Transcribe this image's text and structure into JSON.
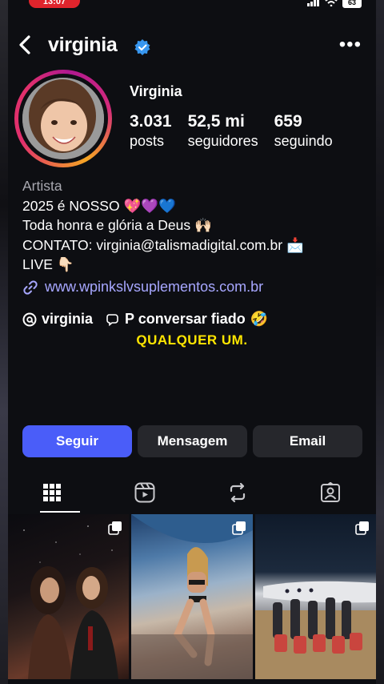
{
  "status_bar": {
    "time": "13:07",
    "battery": "63"
  },
  "header": {
    "username": "virginia",
    "more": "•••"
  },
  "profile": {
    "display_name": "Virginia",
    "stats": [
      {
        "value": "3.031",
        "label": "posts"
      },
      {
        "value": "52,5 mi",
        "label": "seguidores"
      },
      {
        "value": "659",
        "label": "seguindo"
      }
    ]
  },
  "bio": {
    "category": "Artista",
    "line1": "2025 é NOSSO",
    "line1_emoji": "💖💜💙",
    "line2": "Toda honra e glória a Deus",
    "line2_emoji": "🙌🏻",
    "line3": "CONTATO: virginia@talismadigital.com.br",
    "line3_emoji": "📩",
    "line4": "LIVE",
    "line4_emoji": "👇🏻",
    "link": "www.wpinkslvsuplementos.com.br",
    "threads_name": "virginia",
    "channel": "P conversar fiado",
    "channel_emoji": "🤣"
  },
  "caption": "QUALQUER UM.",
  "buttons": {
    "follow": "Seguir",
    "message": "Mensagem",
    "email": "Email"
  },
  "tabs": [
    "grid-icon",
    "reels-icon",
    "reposts-icon",
    "tagged-icon"
  ],
  "colors": {
    "follow": "#4a5df9",
    "link": "#a7a7ff",
    "caption": "#ffe600",
    "verified": "#3897f0"
  }
}
